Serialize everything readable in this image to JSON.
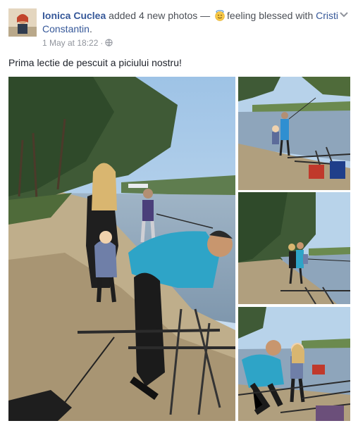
{
  "post": {
    "author": "Ionica Cuclea",
    "action": " added 4 new photos — ",
    "feeling": "feeling blessed with",
    "tagged": "Cristi Constantin",
    "tagged_suffix": ".",
    "timestamp": "1 May at 18:22",
    "separator": "·",
    "text": "Prima lectie de pescuit a piciului nostru!"
  },
  "icons": {
    "feeling": "smiling-face-with-halo-icon",
    "privacy": "globe-icon",
    "menu": "chevron-down-icon"
  },
  "colors": {
    "link": "#365899",
    "meta": "#90949c",
    "text": "#1d2129"
  },
  "photos": {
    "count": 4
  }
}
